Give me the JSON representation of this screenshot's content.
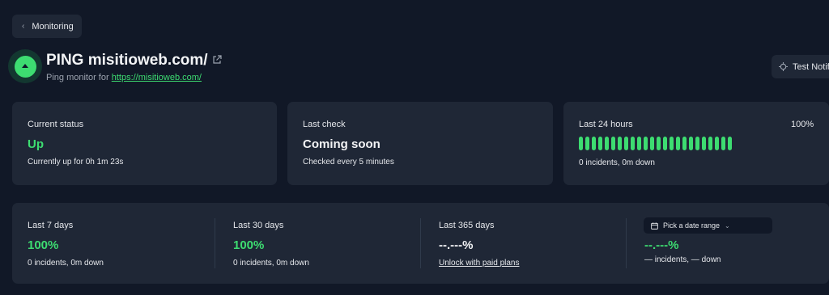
{
  "nav": {
    "back_label": "Monitoring"
  },
  "header": {
    "title": "PING misitioweb.com/",
    "subtitle_prefix": "Ping monitor for",
    "subtitle_link": "https://misitioweb.com/",
    "test_button": "Test Notif"
  },
  "cards": {
    "current_status": {
      "label": "Current status",
      "value": "Up",
      "detail": "Currently up for 0h 1m 23s"
    },
    "last_check": {
      "label": "Last check",
      "value": "Coming soon",
      "detail": "Checked every 5 minutes"
    },
    "last_24h": {
      "label": "Last 24 hours",
      "percent": "100%",
      "detail": "0 incidents, 0m down",
      "bar_count": 24,
      "bar_color": "#3ddc71"
    }
  },
  "periods": [
    {
      "label": "Last 7 days",
      "value": "100%",
      "detail": "0 incidents, 0m down"
    },
    {
      "label": "Last 30 days",
      "value": "100%",
      "detail": "0 incidents, 0m down"
    },
    {
      "label": "Last 365 days",
      "value": "--.---%",
      "detail": "Unlock with paid plans"
    },
    {
      "range_button": "Pick a date range",
      "value": "--.---%",
      "detail": "— incidents, — down"
    }
  ],
  "colors": {
    "accent": "#3ddc71",
    "background": "#111827",
    "card": "#1f2736"
  }
}
